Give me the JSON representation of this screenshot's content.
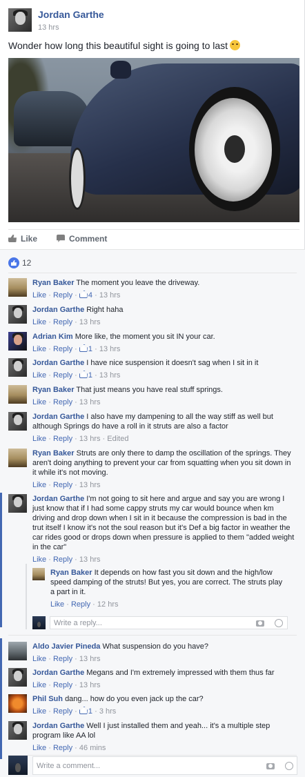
{
  "post": {
    "author": "Jordan Garthe",
    "time": "13 hrs",
    "text": "Wonder how long this beautiful sight is going to last",
    "emoji_icon": "laughing-emoji-icon"
  },
  "actions": {
    "like_label": "Like",
    "comment_label": "Comment"
  },
  "reactions": {
    "count": "12"
  },
  "comments": [
    {
      "author": "Ryan Baker",
      "text": "The moment you leave the driveway.",
      "likes": "4",
      "time": "13 hrs",
      "edited": ""
    },
    {
      "author": "Jordan Garthe",
      "text": "Right haha",
      "likes": "",
      "time": "13 hrs",
      "edited": ""
    },
    {
      "author": "Adrian Kim",
      "text": "More like, the moment you sit IN your car.",
      "likes": "1",
      "time": "13 hrs",
      "edited": ""
    },
    {
      "author": "Jordan Garthe",
      "text": "I have nice suspension it doesn't sag when I sit in it",
      "likes": "1",
      "time": "13 hrs",
      "edited": ""
    },
    {
      "author": "Ryan Baker",
      "text": "That just means you have real stuff springs.",
      "likes": "",
      "time": "13 hrs",
      "edited": ""
    },
    {
      "author": "Jordan Garthe",
      "text": "I also have my dampening to all the way stiff as well but although Springs do have a roll in it struts are also a factor",
      "likes": "",
      "time": "13 hrs",
      "edited": "Edited"
    },
    {
      "author": "Ryan Baker",
      "text": "Struts are only there to damp the oscillation of the springs. They aren't doing anything to prevent your car from squatting when you sit down in it while it's not moving.",
      "likes": "",
      "time": "13 hrs",
      "edited": ""
    },
    {
      "author": "Jordan Garthe",
      "text": "I'm not going to sit here and argue and say you are wrong I just know that if I had some cappy struts my car would bounce when km driving and drop down when I sit in it because the compression is bad in the trut itself I know it's not the soul reason but it's Def a big factor in weather the car rides good or drops down when pressure is applied to them \"added weight in the car\"",
      "likes": "",
      "time": "13 hrs",
      "edited": ""
    },
    {
      "author": "Aldo Javier Pineda",
      "text": "What suspension do you have?",
      "likes": "",
      "time": "13 hrs",
      "edited": ""
    },
    {
      "author": "Jordan Garthe",
      "text": "Megans and I'm extremely impressed with them thus far",
      "likes": "",
      "time": "13 hrs",
      "edited": ""
    },
    {
      "author": "Phil Suh",
      "text": "dang... how do you even jack up the car?",
      "likes": "1",
      "time": "3 hrs",
      "edited": ""
    },
    {
      "author": "Jordan Garthe",
      "text": "Well I just installed them and yeah... it's a multiple step program like AA lol",
      "likes": "",
      "time": "46 mins",
      "edited": ""
    }
  ],
  "reply": {
    "author": "Ryan Baker",
    "text": "It depends on how fast you sit down and the high/low speed damping of the struts! But yes, you are correct. The struts play a part in it.",
    "time": "12 hrs",
    "placeholder": "Write a reply..."
  },
  "comment_ui": {
    "like": "Like",
    "reply": "Reply",
    "sep": "·",
    "placeholder": "Write a comment..."
  },
  "colors": {
    "link": "#365899",
    "accent": "#4267b2",
    "meta": "#90949c"
  }
}
